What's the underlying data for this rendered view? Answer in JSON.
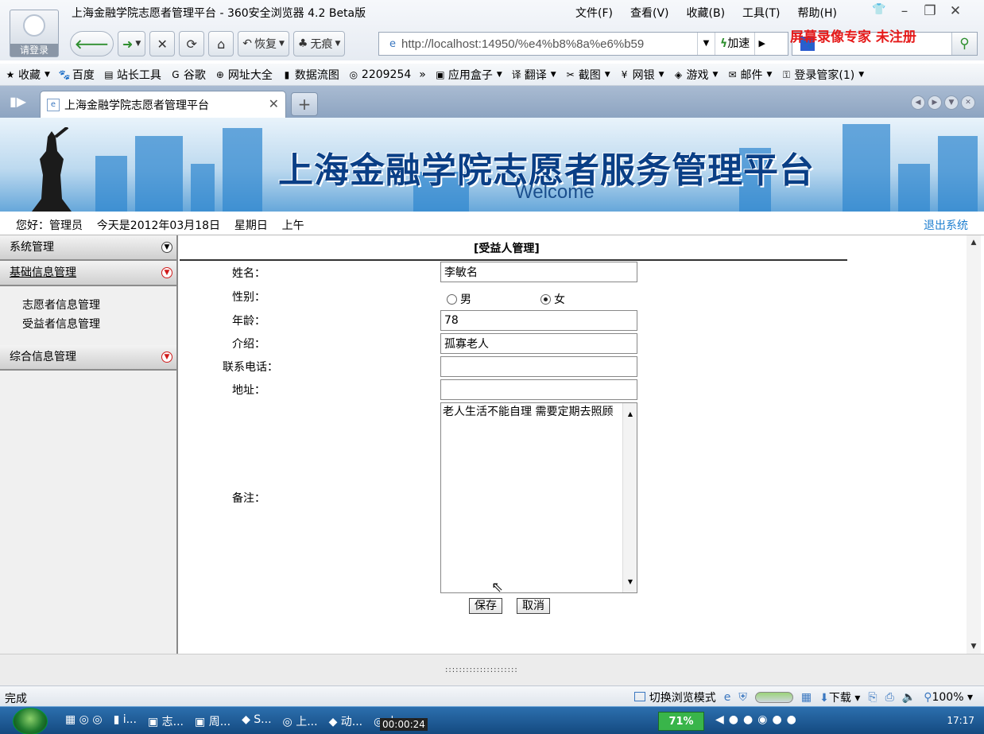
{
  "window": {
    "title": "上海金融学院志愿者管理平台 - 360安全浏览器 4.2 Beta版",
    "avatar_label": "请登录",
    "menu": [
      "文件(F)",
      "查看(V)",
      "收藏(B)",
      "工具(T)",
      "帮助(H)"
    ]
  },
  "toolbar": {
    "restore_label": "恢复",
    "private_label": "无痕",
    "url": "http://localhost:14950/%e4%b8%8a%e6%b59",
    "accelerate_label": "加速",
    "watermark": "屏幕录像专家  未注册"
  },
  "favorites": [
    {
      "label": "收藏",
      "icon": "star-icon",
      "has_menu": true
    },
    {
      "label": "百度",
      "icon": "baidu-icon",
      "has_menu": false
    },
    {
      "label": "站长工具",
      "icon": "page-icon",
      "has_menu": false
    },
    {
      "label": "谷歌",
      "icon": "google-icon",
      "has_menu": false
    },
    {
      "label": "网址大全",
      "icon": "plus-circle-icon",
      "has_menu": false
    },
    {
      "label": "数据流图",
      "icon": "folder-icon",
      "has_menu": false
    },
    {
      "label": "2209254",
      "icon": "globe-icon",
      "has_menu": false
    },
    {
      "label": "»",
      "icon": "more-icon",
      "has_menu": false
    },
    {
      "label": "应用盒子",
      "icon": "box-icon",
      "has_menu": true
    },
    {
      "label": "翻译",
      "icon": "translate-icon",
      "has_menu": true
    },
    {
      "label": "截图",
      "icon": "screenshot-icon",
      "has_menu": true
    },
    {
      "label": "网银",
      "icon": "bank-icon",
      "has_menu": true
    },
    {
      "label": "游戏",
      "icon": "game-icon",
      "has_menu": true
    },
    {
      "label": "邮件",
      "icon": "mail-icon",
      "has_menu": true
    },
    {
      "label": "登录管家(1)",
      "icon": "key-icon",
      "has_menu": true
    }
  ],
  "tab": {
    "title": "上海金融学院志愿者管理平台"
  },
  "banner": {
    "title": "上海金融学院志愿者服务管理平台",
    "subtitle": "Welcome"
  },
  "header": {
    "greeting": "您好：管理员    今天是2012年03月18日    星期日    上午",
    "logout_label": "退出系统"
  },
  "sidebar": {
    "sections": [
      {
        "label": "系统管理",
        "open": false,
        "items": []
      },
      {
        "label": "基础信息管理",
        "open": true,
        "items": [
          "志愿者信息管理",
          "受益者信息管理"
        ]
      },
      {
        "label": "综合信息管理",
        "open": false,
        "items": []
      }
    ]
  },
  "form": {
    "title": "[受益人管理]",
    "fields": {
      "name": {
        "label": "姓名：",
        "value": "李敏名"
      },
      "gender": {
        "label": "性别：",
        "options": [
          "男",
          "女"
        ],
        "selected": "女"
      },
      "age": {
        "label": "年龄：",
        "value": "78"
      },
      "intro": {
        "label": "介绍：",
        "value": "孤寡老人"
      },
      "phone": {
        "label": "联系电话：",
        "value": ""
      },
      "address": {
        "label": "地址：",
        "value": ""
      },
      "notes": {
        "label": "备注：",
        "value": "老人生活不能自理 需要定期去照顾"
      }
    },
    "save_label": "保存",
    "cancel_label": "取消"
  },
  "statusbar": {
    "status": "完成",
    "mode_label": "切换浏览模式",
    "download_label": "下载",
    "zoom": "100%"
  },
  "taskbar": {
    "items": [
      "i...",
      "志...",
      "周...",
      "S...",
      "上...",
      "动...",
      "上..."
    ],
    "timer": "00:00:24",
    "battery": "71%",
    "clock": "17:17"
  },
  "colors": {
    "link_blue": "#1e7fd0",
    "watermark_red": "#e51a1a",
    "banner_title": "#0a3f86",
    "taskbar": "#1b5a96"
  }
}
